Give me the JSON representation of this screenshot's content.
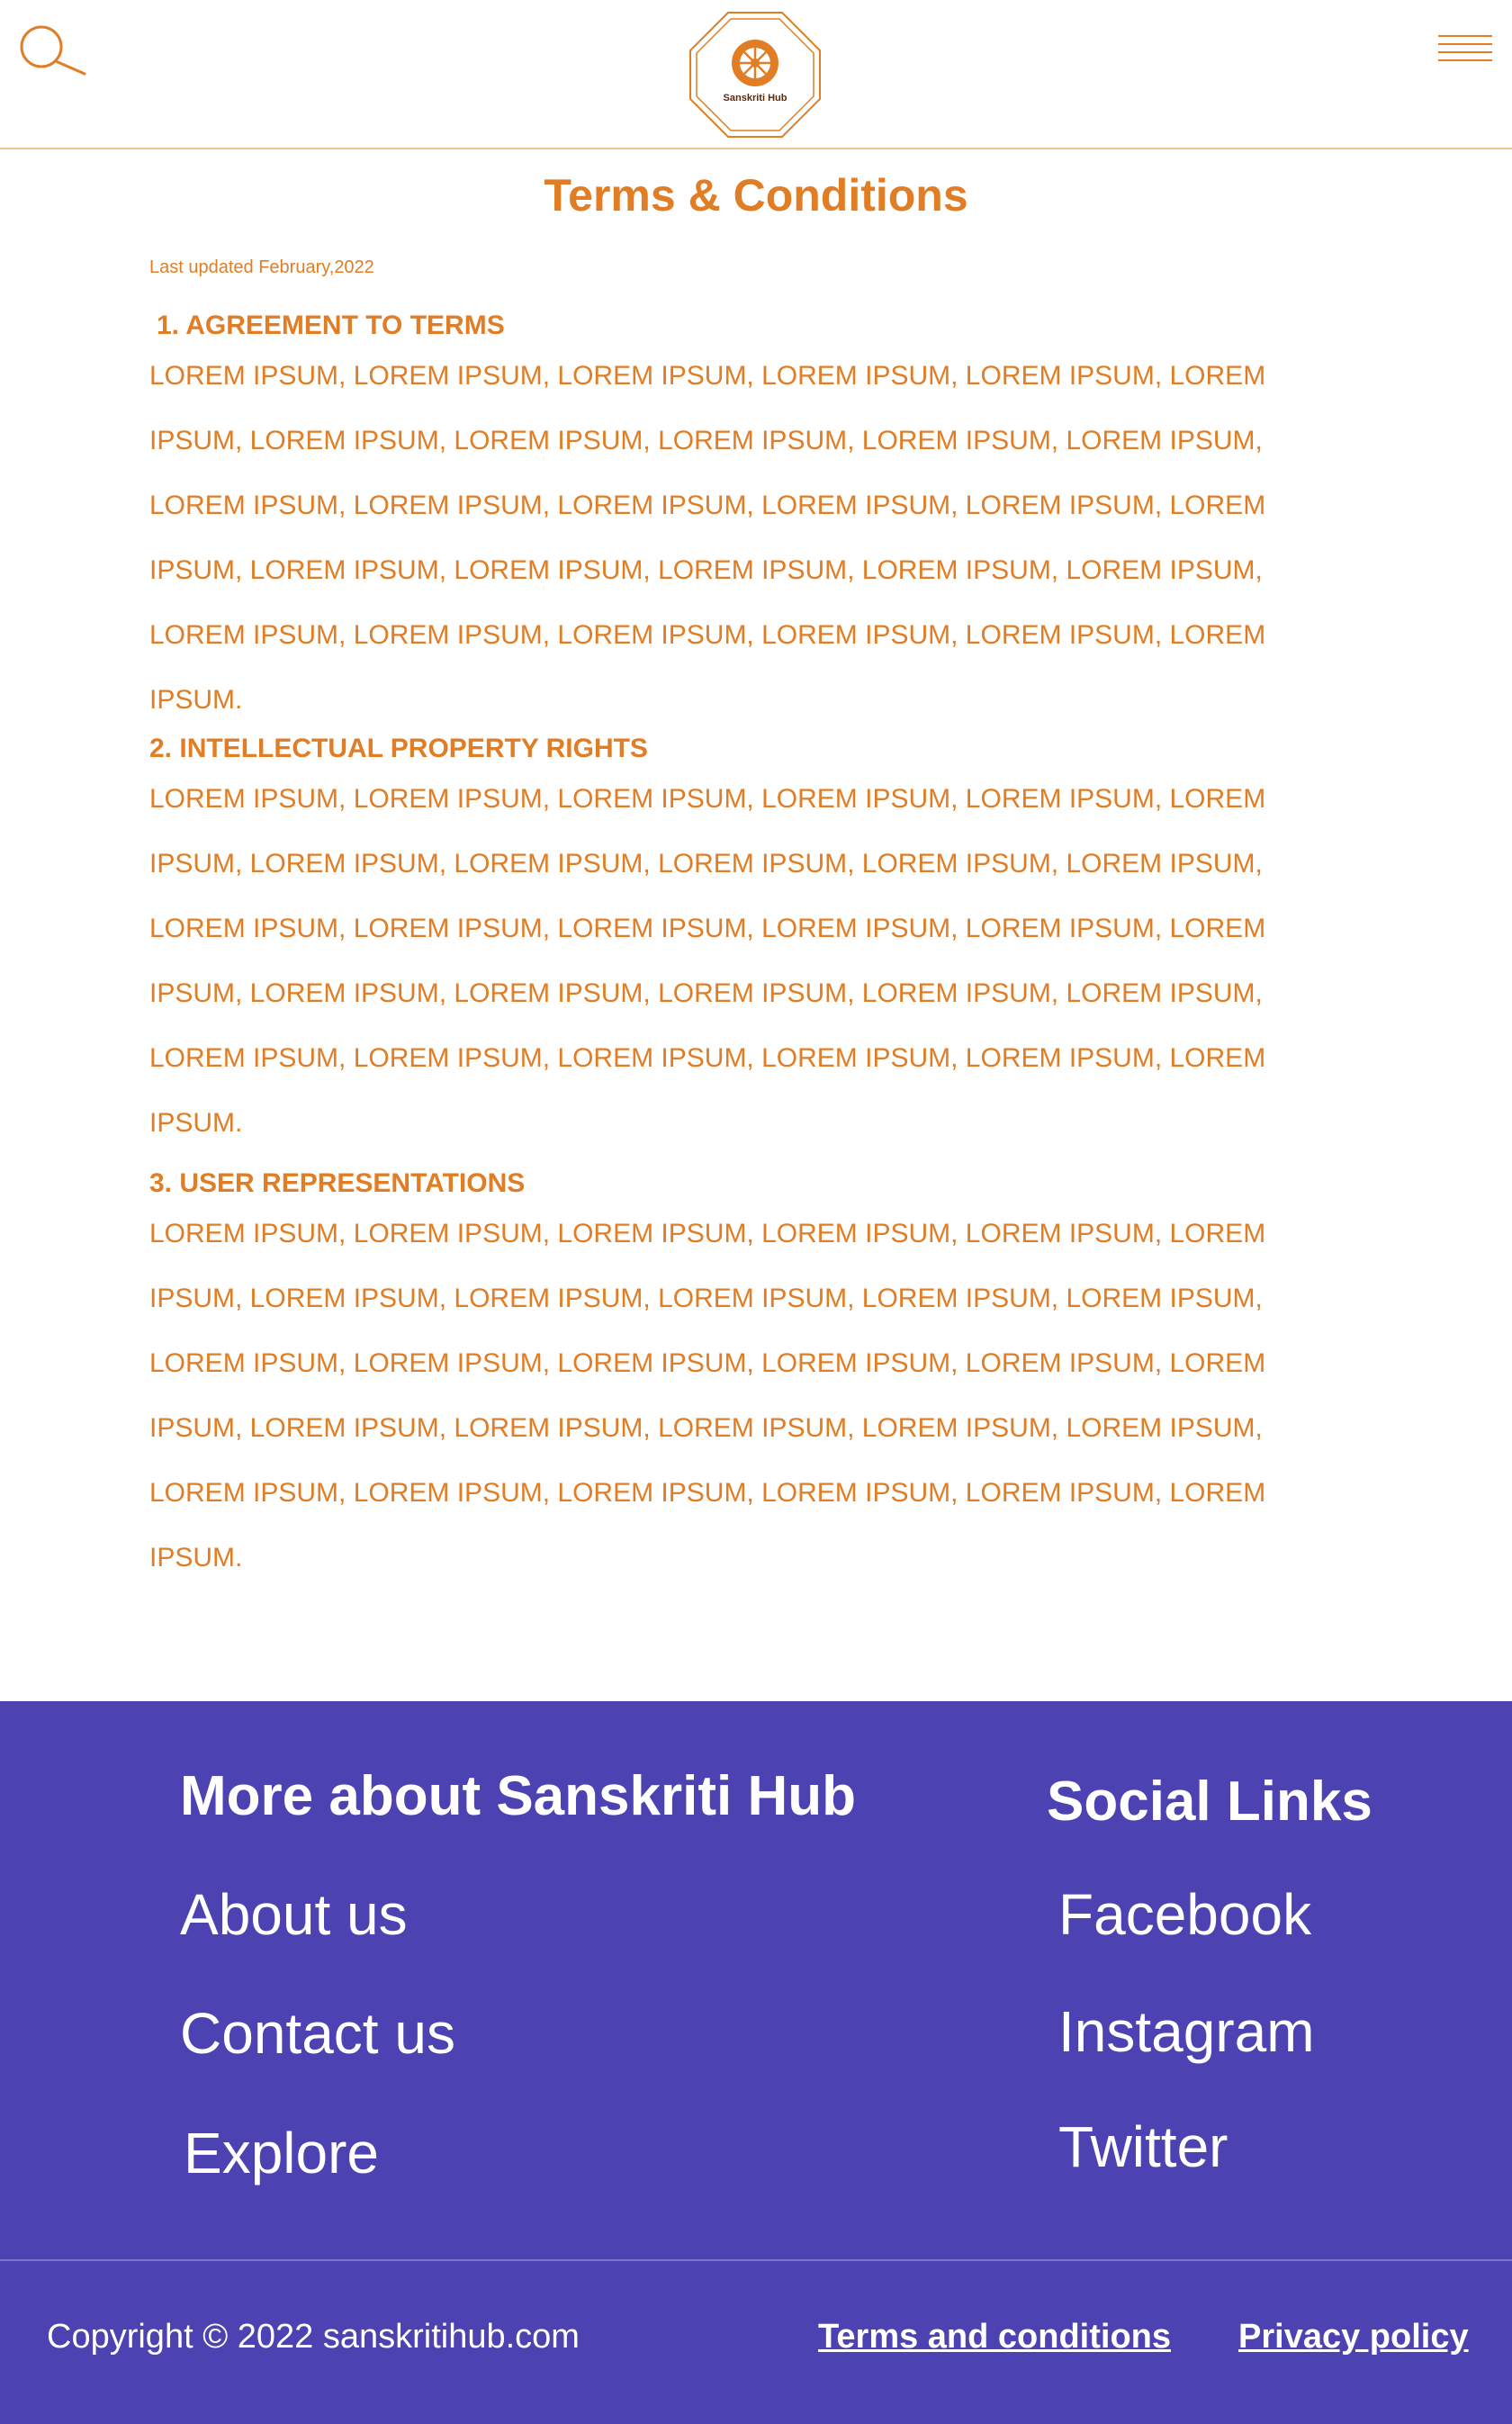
{
  "header": {
    "logo_text": "Sanskriti Hub",
    "icons": {
      "search": "search-icon",
      "menu": "hamburger-menu-icon",
      "logo": "dharma-wheel-icon"
    }
  },
  "colors": {
    "accent": "#e07d25",
    "footer_bg": "#4d42b1",
    "footer_text": "#ffffff"
  },
  "main": {
    "title": "Terms & Conditions",
    "last_updated": "Last updated February,2022",
    "sections": [
      {
        "heading": "1. AGREEMENT TO TERMS",
        "lines": [
          "LOREM IPSUM, LOREM IPSUM, LOREM IPSUM, LOREM IPSUM, LOREM IPSUM, LOREM",
          "IPSUM, LOREM IPSUM, LOREM IPSUM, LOREM IPSUM, LOREM IPSUM, LOREM IPSUM,",
          "LOREM IPSUM, LOREM IPSUM, LOREM IPSUM, LOREM IPSUM, LOREM IPSUM, LOREM",
          "IPSUM, LOREM IPSUM, LOREM IPSUM, LOREM IPSUM, LOREM IPSUM, LOREM IPSUM,",
          "LOREM IPSUM, LOREM IPSUM, LOREM IPSUM, LOREM IPSUM, LOREM IPSUM, LOREM",
          "IPSUM."
        ]
      },
      {
        "heading": "2. INTELLECTUAL PROPERTY RIGHTS",
        "lines": [
          "LOREM IPSUM, LOREM IPSUM, LOREM IPSUM, LOREM IPSUM, LOREM IPSUM, LOREM",
          "IPSUM, LOREM IPSUM, LOREM IPSUM, LOREM IPSUM, LOREM IPSUM, LOREM IPSUM,",
          "LOREM IPSUM, LOREM IPSUM, LOREM IPSUM, LOREM IPSUM, LOREM IPSUM, LOREM",
          "IPSUM, LOREM IPSUM, LOREM IPSUM, LOREM IPSUM, LOREM IPSUM, LOREM IPSUM,",
          "LOREM IPSUM, LOREM IPSUM, LOREM IPSUM, LOREM IPSUM, LOREM IPSUM, LOREM",
          "IPSUM."
        ]
      },
      {
        "heading": "3. USER REPRESENTATIONS",
        "lines": [
          "LOREM IPSUM, LOREM IPSUM, LOREM IPSUM, LOREM IPSUM, LOREM IPSUM, LOREM",
          "IPSUM, LOREM IPSUM, LOREM IPSUM, LOREM IPSUM, LOREM IPSUM, LOREM IPSUM,",
          "LOREM IPSUM, LOREM IPSUM, LOREM IPSUM, LOREM IPSUM, LOREM IPSUM, LOREM",
          "IPSUM, LOREM IPSUM, LOREM IPSUM, LOREM IPSUM, LOREM IPSUM, LOREM IPSUM,",
          "LOREM IPSUM, LOREM IPSUM, LOREM IPSUM, LOREM IPSUM, LOREM IPSUM, LOREM",
          "IPSUM."
        ]
      }
    ]
  },
  "footer": {
    "more_heading": "More about Sanskriti Hub",
    "more_links": [
      "About us",
      "Contact us",
      "Explore"
    ],
    "social_heading": "Social Links",
    "social_links": [
      "Facebook",
      "Instagram",
      "Twitter"
    ],
    "copyright": "Copyright © 2022 sanskritihub.com",
    "terms_link": "Terms and conditions",
    "privacy_link": "Privacy policy"
  }
}
